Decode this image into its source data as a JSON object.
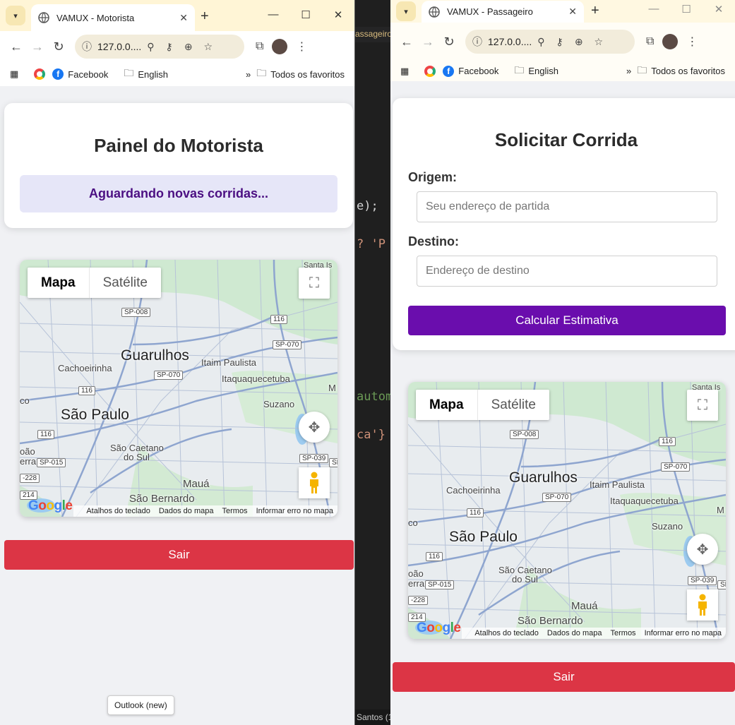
{
  "editor": {
    "tab_label": "assageiro",
    "lines": [
      {
        "text": "e);",
        "color": "#d4d4d4"
      },
      {
        "text": "? 'P",
        "color": "#ce9178"
      },
      {
        "text": "autom",
        "color": "#6a9955"
      },
      {
        "text": "ca'}",
        "color": "#ce9178"
      }
    ],
    "status": "Santos (1"
  },
  "driver": {
    "tab_title": "VAMUX - Motorista",
    "url": "127.0.0....",
    "bookmarks": [
      "Facebook",
      "English"
    ],
    "bookmarks_overflow": "»",
    "all_bookmarks": "Todos os favoritos",
    "heading": "Painel do Motorista",
    "status": "Aguardando novas corridas...",
    "logout": "Sair",
    "tooltip": "Outlook (new)"
  },
  "passenger": {
    "tab_title": "VAMUX - Passageiro",
    "url": "127.0.0....",
    "bookmarks": [
      "Facebook",
      "English"
    ],
    "bookmarks_overflow": "»",
    "all_bookmarks": "Todos os favoritos",
    "heading": "Solicitar Corrida",
    "origin_label": "Origem:",
    "origin_placeholder": "Seu endereço de partida",
    "dest_label": "Destino:",
    "dest_placeholder": "Endereço de destino",
    "estimate_button": "Calcular Estimativa",
    "logout": "Sair"
  },
  "map": {
    "type_map": "Mapa",
    "type_satellite": "Satélite",
    "places": {
      "guarulhos": "Guarulhos",
      "sao_paulo": "São Paulo",
      "cachoeirinha": "Cachoeirinha",
      "itaim": "Itaim Paulista",
      "itaqua": "Itaquaquecetuba",
      "suzano": "Suzano",
      "sao_caetano": "São Caetano",
      "do_sul": "do Sul",
      "maua": "Mauá",
      "sao_bernardo": "São Bernardo",
      "santa": "Santa Is",
      "co": "co",
      "oao": "oão",
      "erra": "erra",
      "m": "M"
    },
    "shields": [
      "SP-008",
      "116",
      "SP-070",
      "SP-070",
      "116",
      "116",
      "SP-015",
      "SP-039",
      "-228",
      "214",
      "SP"
    ],
    "footer": [
      "Atalhos do teclado",
      "Dados do mapa",
      "Termos",
      "Informar erro no mapa"
    ],
    "logo": "Google"
  },
  "colors": {
    "accent_purple": "#6a0dad",
    "danger_red": "#dc3545",
    "status_bg": "#e6e6f8",
    "status_text": "#4b0f82"
  }
}
